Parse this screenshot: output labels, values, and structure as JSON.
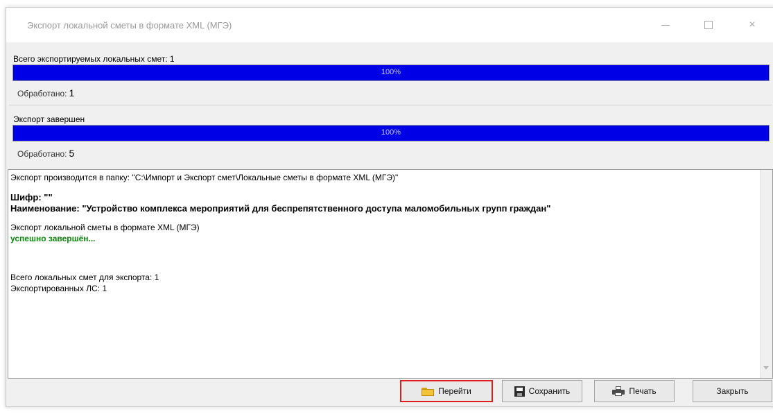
{
  "window": {
    "title": "Экспорт локальной сметы в формате XML (МГЭ)",
    "controls": {
      "minimize": "minimize-icon",
      "maximize": "maximize-icon",
      "close": "×"
    }
  },
  "progress": [
    {
      "label": "Всего экспортируемых локальных смет: 1",
      "percent_text": "100%",
      "value": 1.0,
      "processed_label": "Обработано:",
      "processed_count": "1"
    },
    {
      "label": "Экспорт завершен",
      "percent_text": "100%",
      "value": 1.0,
      "processed_label": "Обработано:",
      "processed_count": "5"
    }
  ],
  "log": {
    "folder_line": "Экспорт производится в папку: \"C:\\Импорт и Экспорт смет\\Локальные сметы в формате XML (МГЭ)\"",
    "cipher_line": "Шифр: \"\"",
    "name_line": "Наименование: \"Устройство комплекса мероприятий для беспрепятственного доступа маломобильных групп граждан\"",
    "export_line": "Экспорт локальной сметы в формате XML (МГЭ)",
    "success_line": "успешно завершён...",
    "total_line": "Всего локальных смет для экспорта: 1",
    "exported_line": "Экспортированных ЛС: 1"
  },
  "buttons": {
    "go": "Перейти",
    "save": "Сохранить",
    "print": "Печать",
    "close": "Закрыть"
  },
  "colors": {
    "progress_fill": "#0000e6",
    "success_text": "#0a8a0a",
    "highlight_border": "#e11d1d"
  }
}
